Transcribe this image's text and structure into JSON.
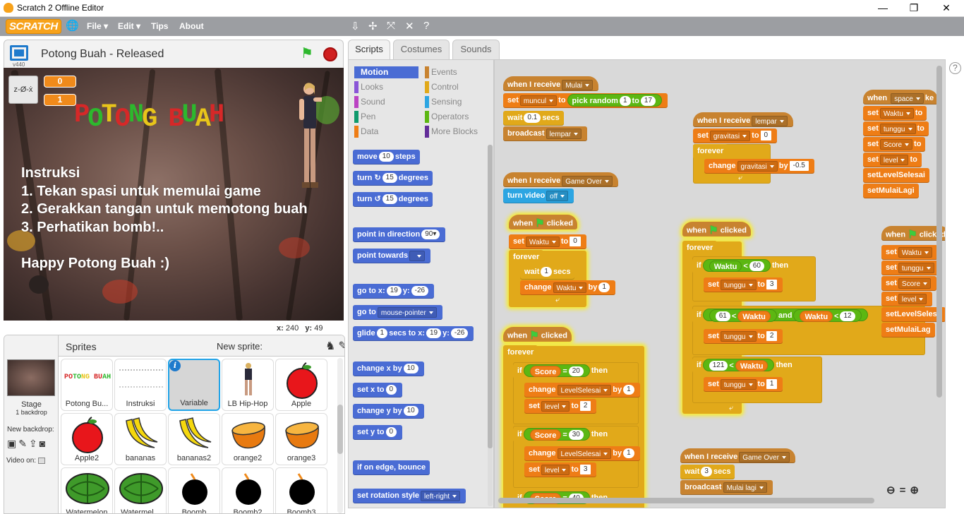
{
  "window": {
    "title": "Scratch 2 Offline Editor",
    "minimize": "—",
    "restore": "❐",
    "close": "✕"
  },
  "menubar": {
    "logo": "SCRATCH",
    "globe": "🌐",
    "items": [
      "File ▾",
      "Edit ▾",
      "Tips",
      "About"
    ],
    "tools": [
      "⇩",
      "✢",
      "⤧",
      "✕",
      "?"
    ]
  },
  "stage": {
    "version": "v440",
    "project_title": "Potong Buah - Released",
    "flag": "⚑",
    "counters": [
      "0",
      "1"
    ],
    "zoom_icon": "z-Ø-ẋ",
    "game_title": [
      {
        "ch": "P",
        "color": "#d62828"
      },
      {
        "ch": "O",
        "color": "#2db82d"
      },
      {
        "ch": "T",
        "color": "#e8c51a"
      },
      {
        "ch": "O",
        "color": "#d62828"
      },
      {
        "ch": "N",
        "color": "#2db82d"
      },
      {
        "ch": "G",
        "color": "#e8c51a"
      },
      {
        "ch": " ",
        "color": "#fff"
      },
      {
        "ch": "B",
        "color": "#d62828"
      },
      {
        "ch": "U",
        "color": "#2db82d"
      },
      {
        "ch": "A",
        "color": "#e8c51a"
      },
      {
        "ch": "H",
        "color": "#d62828"
      }
    ],
    "instructions": "Instruksi\n1. Tekan spasi untuk memulai game\n2. Gerakkan tangan untuk memotong buah\n3. Perhatikan bomb!..\n\nHappy Potong Buah :)",
    "coords": {
      "x_label": "x:",
      "x": "240",
      "y_label": "y:",
      "y": "49"
    }
  },
  "sprites_pane": {
    "stage_label": "Stage",
    "stage_sub": "1 backdrop",
    "new_backdrop": "New backdrop:",
    "video_on": "Video on:",
    "header": "Sprites",
    "new_sprite": "New sprite:",
    "tiles": [
      {
        "name": "Potong Bu..."
      },
      {
        "name": "Instruksi"
      },
      {
        "name": "Variable"
      },
      {
        "name": "LB Hip-Hop"
      },
      {
        "name": "Apple"
      },
      {
        "name": "Apple2"
      },
      {
        "name": "bananas"
      },
      {
        "name": "bananas2"
      },
      {
        "name": "orange2"
      },
      {
        "name": "orange3"
      },
      {
        "name": "Watermelon"
      },
      {
        "name": "Watermel..."
      },
      {
        "name": "Boomb"
      },
      {
        "name": "Boomb2"
      },
      {
        "name": "Boomb3"
      }
    ]
  },
  "tabs": [
    "Scripts",
    "Costumes",
    "Sounds"
  ],
  "categories": [
    {
      "label": "Motion",
      "color": "#4a6cd4"
    },
    {
      "label": "Events",
      "color": "#c88330"
    },
    {
      "label": "Looks",
      "color": "#8a55d7"
    },
    {
      "label": "Control",
      "color": "#e1a91a"
    },
    {
      "label": "Sound",
      "color": "#bb42c3"
    },
    {
      "label": "Sensing",
      "color": "#2ca5e2"
    },
    {
      "label": "Pen",
      "color": "#0e9a6c"
    },
    {
      "label": "Operators",
      "color": "#5cb712"
    },
    {
      "label": "Data",
      "color": "#ee7d16"
    },
    {
      "label": "More Blocks",
      "color": "#632d99"
    }
  ],
  "palette": {
    "move": "move",
    "move_v": "10",
    "steps": "steps",
    "turn": "turn",
    "turn_cw": "↻",
    "turn_ccw": "↺",
    "turn_v": "15",
    "degrees": "degrees",
    "point_dir": "point in direction",
    "point_dir_v": "90▾",
    "point_towards": "point towards",
    "goto_xy": "go to x:",
    "goto_x": "19",
    "y_lbl": "y:",
    "goto_y": "-26",
    "goto": "go to",
    "goto_target": "mouse-pointer",
    "glide": "glide",
    "glide_v": "1",
    "secs_to_x": "secs to x:",
    "glide_x": "19",
    "glide_y": "-26",
    "change_x": "change x by",
    "change_x_v": "10",
    "set_x": "set x to",
    "set_x_v": "0",
    "change_y": "change y by",
    "change_y_v": "10",
    "set_y": "set y to",
    "set_y_v": "0",
    "bounce": "if on edge, bounce",
    "rotation": "set rotation style",
    "rotation_v": "left-right"
  },
  "scripts": {
    "when_receive": "when I receive",
    "when": "when",
    "clicked": "clicked",
    "set": "set",
    "to": "to",
    "change": "change",
    "by": "by",
    "wait": "wait",
    "secs": "secs",
    "broadcast": "broadcast",
    "forever": "forever",
    "if": "if",
    "then": "then",
    "and": "and",
    "lt": "<",
    "eq": "=",
    "pick_random": "pick random",
    "turn_video": "turn video",
    "msg_mulai": "Mulai",
    "msg_lempar": "lempar",
    "msg_gameover": "Game Over",
    "msg_mulailagi": "Mulai lagi",
    "var_muncul": "muncul",
    "var_gravitasi": "gravitasi",
    "var_waktu": "Waktu",
    "var_tunggu": "tunggu",
    "var_score": "Score",
    "var_level": "level",
    "var_levelselesai": "LevelSelesai",
    "var_levelsel_short": "LevelSelesa",
    "var_mulailagi": "MulaiLagi",
    "var_mulailag_short": "MulaiLag",
    "v1": "1",
    "v17": "17",
    "v01": "0.1",
    "v0": "0",
    "vneg05": "-0.5",
    "voff": "off",
    "v60": "60",
    "v3": "3",
    "v61": "61",
    "v12": "12",
    "v2": "2",
    "v121": "121",
    "v20": "20",
    "v30": "30",
    "v40": "40",
    "space": "space",
    "ke": "ke",
    "end_arrow": "⤶",
    "zoom_out": "⊖",
    "zoom_reset": "=",
    "zoom_in": "⊕"
  },
  "help": "?"
}
